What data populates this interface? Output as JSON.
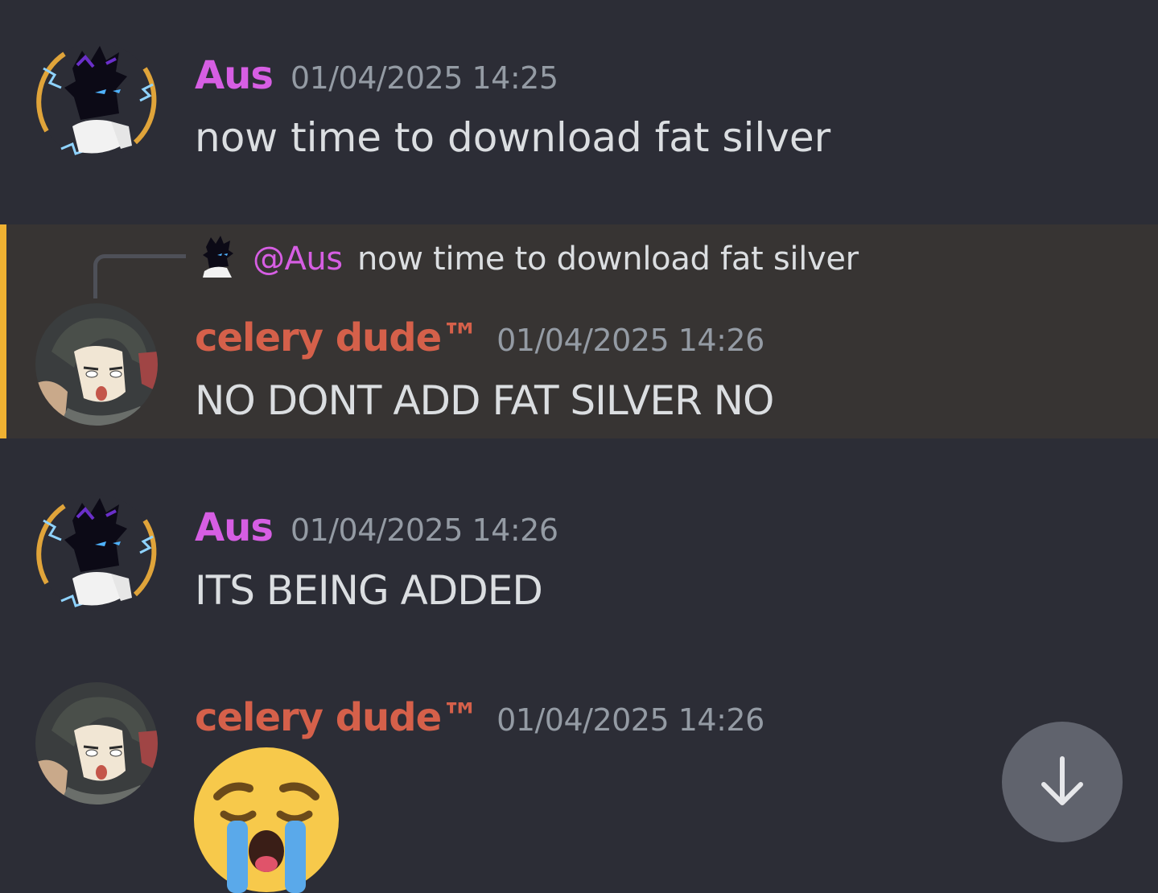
{
  "messages": [
    {
      "author": "Aus",
      "timestamp": "01/04/2025 14:25",
      "content": "now time to download fat silver",
      "avatar_icon": "shadow-character-avatar"
    },
    {
      "author": "celery dude™",
      "timestamp": "01/04/2025 14:26",
      "content": "NO DONT ADD FAT SILVER NO",
      "avatar_icon": "anime-character-avatar",
      "highlighted": true,
      "reply": {
        "mention": "@Aus",
        "text": "now time to download fat silver"
      }
    },
    {
      "author": "Aus",
      "timestamp": "01/04/2025 14:26",
      "content": "ITS BEING ADDED",
      "avatar_icon": "shadow-character-avatar"
    },
    {
      "author": "celery dude™",
      "timestamp": "01/04/2025 14:26",
      "content_emoji": "loudly-crying-face",
      "avatar_icon": "anime-character-avatar"
    }
  ],
  "scroll_button": {
    "icon": "arrow-down-icon"
  },
  "colors": {
    "background": "#2c2d36",
    "highlight_background": "#373433",
    "highlight_bar": "#f0b232",
    "author_aus": "#d65ee3",
    "author_celery": "#d5604a",
    "timestamp": "#949ba4",
    "text": "#dbdee1"
  }
}
